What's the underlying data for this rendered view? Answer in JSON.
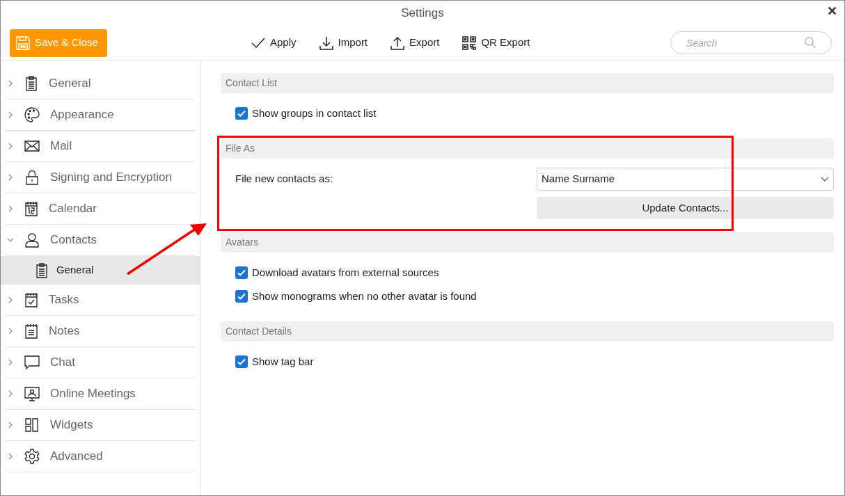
{
  "window": {
    "title": "Settings",
    "close": "✕"
  },
  "toolbar": {
    "save_button": "Save & Close",
    "actions": [
      {
        "kind": "apply",
        "label": "Apply"
      },
      {
        "kind": "import",
        "label": "Import"
      },
      {
        "kind": "export",
        "label": "Export"
      },
      {
        "kind": "qr",
        "label": "QR Export"
      }
    ],
    "search": {
      "placeholder": "Search"
    }
  },
  "sidebar": {
    "items": [
      {
        "kind": "clipboard",
        "label": "General",
        "expanded": false
      },
      {
        "kind": "palette",
        "label": "Appearance",
        "expanded": false
      },
      {
        "kind": "mail",
        "label": "Mail",
        "expanded": false
      },
      {
        "kind": "lock",
        "label": "Signing and Encryption",
        "expanded": false
      },
      {
        "kind": "calendar",
        "label": "Calendar",
        "expanded": false
      },
      {
        "kind": "person",
        "label": "Contacts",
        "expanded": true,
        "children": [
          {
            "kind": "clipboard",
            "label": "General",
            "selected": true
          }
        ]
      },
      {
        "kind": "tasks",
        "label": "Tasks",
        "expanded": false
      },
      {
        "kind": "notes",
        "label": "Notes",
        "expanded": false
      },
      {
        "kind": "chat",
        "label": "Chat",
        "expanded": false
      },
      {
        "kind": "meeting",
        "label": "Online Meetings",
        "expanded": false
      },
      {
        "kind": "widgets",
        "label": "Widgets",
        "expanded": false
      },
      {
        "kind": "gear",
        "label": "Advanced",
        "expanded": false
      }
    ]
  },
  "sections": [
    {
      "title": "Contact List",
      "rows": [
        {
          "kind": "checkbox",
          "label": "Show groups in contact list",
          "checked": true
        }
      ]
    },
    {
      "title": "File As",
      "rows": [
        {
          "kind": "select",
          "label": "File new contacts as:",
          "value": "Name Surname",
          "button": "Update Contacts..."
        }
      ]
    },
    {
      "title": "Avatars",
      "rows": [
        {
          "kind": "checkbox",
          "label": "Download avatars from external sources",
          "checked": true
        },
        {
          "kind": "checkbox",
          "label": "Show monograms when no other avatar is found",
          "checked": true
        }
      ]
    },
    {
      "title": "Contact Details",
      "rows": [
        {
          "kind": "checkbox",
          "label": "Show tag bar",
          "checked": true
        }
      ]
    }
  ]
}
